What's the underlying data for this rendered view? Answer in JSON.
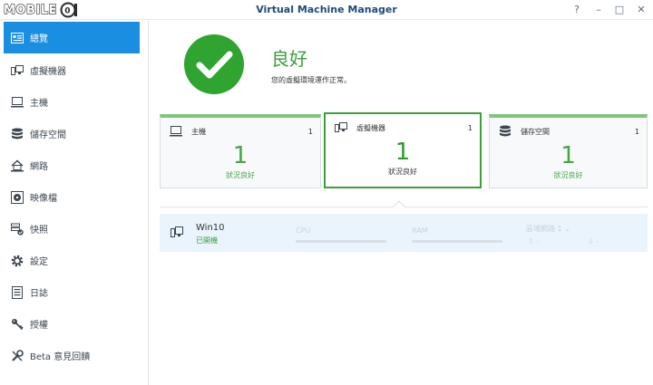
{
  "window": {
    "title": "Virtual Machine Manager",
    "logo_text": "MOBILE",
    "controls": [
      "?",
      "–",
      "□",
      "✕"
    ]
  },
  "sidebar": {
    "items": [
      {
        "label": "總覽",
        "icon": "overview-icon"
      },
      {
        "label": "虛擬機器",
        "icon": "virtual-machine-icon"
      },
      {
        "label": "主機",
        "icon": "host-icon"
      },
      {
        "label": "儲存空間",
        "icon": "storage-icon"
      },
      {
        "label": "網路",
        "icon": "network-icon"
      },
      {
        "label": "映像檔",
        "icon": "image-icon"
      },
      {
        "label": "快照",
        "icon": "snapshot-icon"
      },
      {
        "label": "設定",
        "icon": "gear-icon"
      },
      {
        "label": "日誌",
        "icon": "log-icon"
      },
      {
        "label": "授權",
        "icon": "key-icon"
      },
      {
        "label": "Beta 意見回饋",
        "icon": "wrench-icon"
      }
    ],
    "active_index": 0
  },
  "status": {
    "title": "良好",
    "description": "您的虛擬環境運作正常。"
  },
  "cards": [
    {
      "label": "主機",
      "count": "1",
      "big": "1",
      "sub": "狀況良好"
    },
    {
      "label": "虛擬機器",
      "count": "1",
      "big": "1",
      "sub": "狀況良好"
    },
    {
      "label": "儲存空間",
      "count": "1",
      "big": "1",
      "sub": "狀況良好"
    }
  ],
  "vm": {
    "name": "Win10",
    "status": "已開機",
    "cpu_label": "CPU",
    "ram_label": "RAM",
    "network_label": "區域網路 1",
    "upload": "-",
    "download": "-"
  },
  "colors": {
    "accent": "#1a8ee0",
    "healthy": "#2fa430",
    "title": "#1f4a7a"
  }
}
